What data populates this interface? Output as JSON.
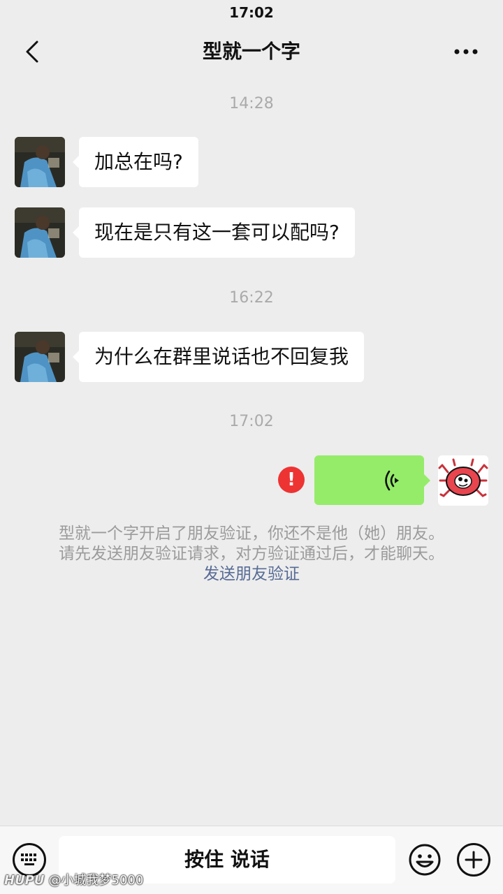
{
  "status_bar": {
    "time": "17:02"
  },
  "nav": {
    "title": "型就一个字",
    "back_icon": "chevron-left-icon",
    "more_icon": "more-dots-icon"
  },
  "messages": [
    {
      "type": "timestamp",
      "text": "14:28"
    },
    {
      "type": "incoming",
      "text": "加总在吗?"
    },
    {
      "type": "incoming",
      "text": "现在是只有这一套可以配吗?"
    },
    {
      "type": "timestamp",
      "text": "16:22"
    },
    {
      "type": "incoming",
      "text": "为什么在群里说话也不回复我"
    },
    {
      "type": "timestamp",
      "text": "17:02"
    },
    {
      "type": "outgoing_voice",
      "status": "failed",
      "error_icon": "!"
    }
  ],
  "system_notice": {
    "line1": "型就一个字开启了朋友验证，你还不是他（她）朋友。",
    "line2": "请先发送朋友验证请求，对方验证通过后，才能聊天。",
    "link": "发送朋友验证"
  },
  "bottom_bar": {
    "hold_to_talk": "按住 说话",
    "keyboard_icon": "keyboard-icon",
    "emoji_icon": "emoji-icon",
    "plus_icon": "plus-icon"
  },
  "watermark": {
    "brand": "HUPU",
    "user": "@小城我梦5000"
  },
  "colors": {
    "background": "#ededed",
    "outgoing_bubble": "#95ec69",
    "link": "#576b95",
    "error": "#ee3333"
  }
}
